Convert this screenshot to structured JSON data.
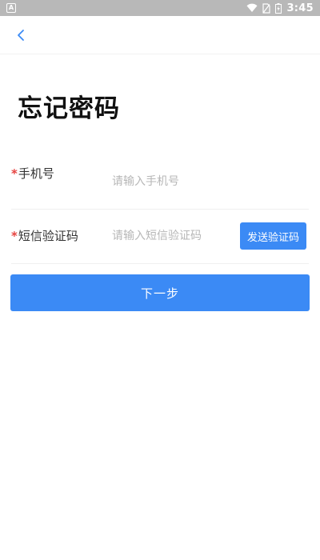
{
  "status_bar": {
    "app_badge": "A",
    "time": "3:45",
    "icons": [
      "wifi-icon",
      "no-sim-icon",
      "battery-charging-icon"
    ]
  },
  "nav": {
    "back_icon": "chevron-left-icon",
    "accent_color": "#3b8af5"
  },
  "page": {
    "title": "忘记密码"
  },
  "form": {
    "required_mark": "*",
    "phone": {
      "label": "手机号",
      "placeholder": "请输入手机号",
      "value": ""
    },
    "sms_code": {
      "label": "短信验证码",
      "placeholder": "请输入短信验证码",
      "value": "",
      "send_button_label": "发送验证码"
    }
  },
  "actions": {
    "next_label": "下一步"
  },
  "colors": {
    "primary": "#3b8af5",
    "required": "#e64340",
    "placeholder": "#b7b7b7"
  }
}
